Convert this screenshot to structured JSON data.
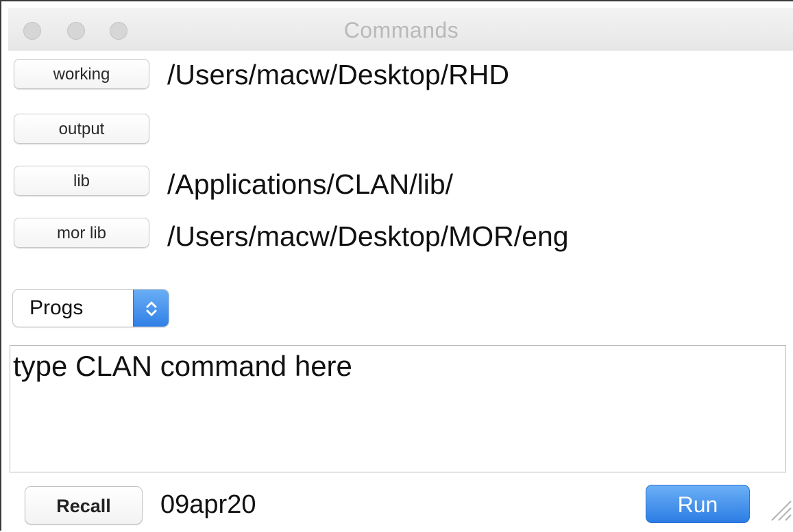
{
  "window": {
    "title": "Commands"
  },
  "paths": {
    "working": {
      "button": "working",
      "value": "/Users/macw/Desktop/RHD"
    },
    "output": {
      "button": "output",
      "value": ""
    },
    "lib": {
      "button": "lib",
      "value": "/Applications/CLAN/lib/"
    },
    "mor_lib": {
      "button": "mor lib",
      "value": "/Users/macw/Desktop/MOR/eng"
    }
  },
  "progs_popup": {
    "selected": "Progs",
    "icon": "updown-chevron-icon"
  },
  "command": {
    "text": "type CLAN command here"
  },
  "footer": {
    "recall_label": "Recall",
    "date": "09apr20",
    "run_label": "Run"
  },
  "colors": {
    "accent_blue": "#2f7fe6",
    "title_gray": "#b9b9b9"
  }
}
